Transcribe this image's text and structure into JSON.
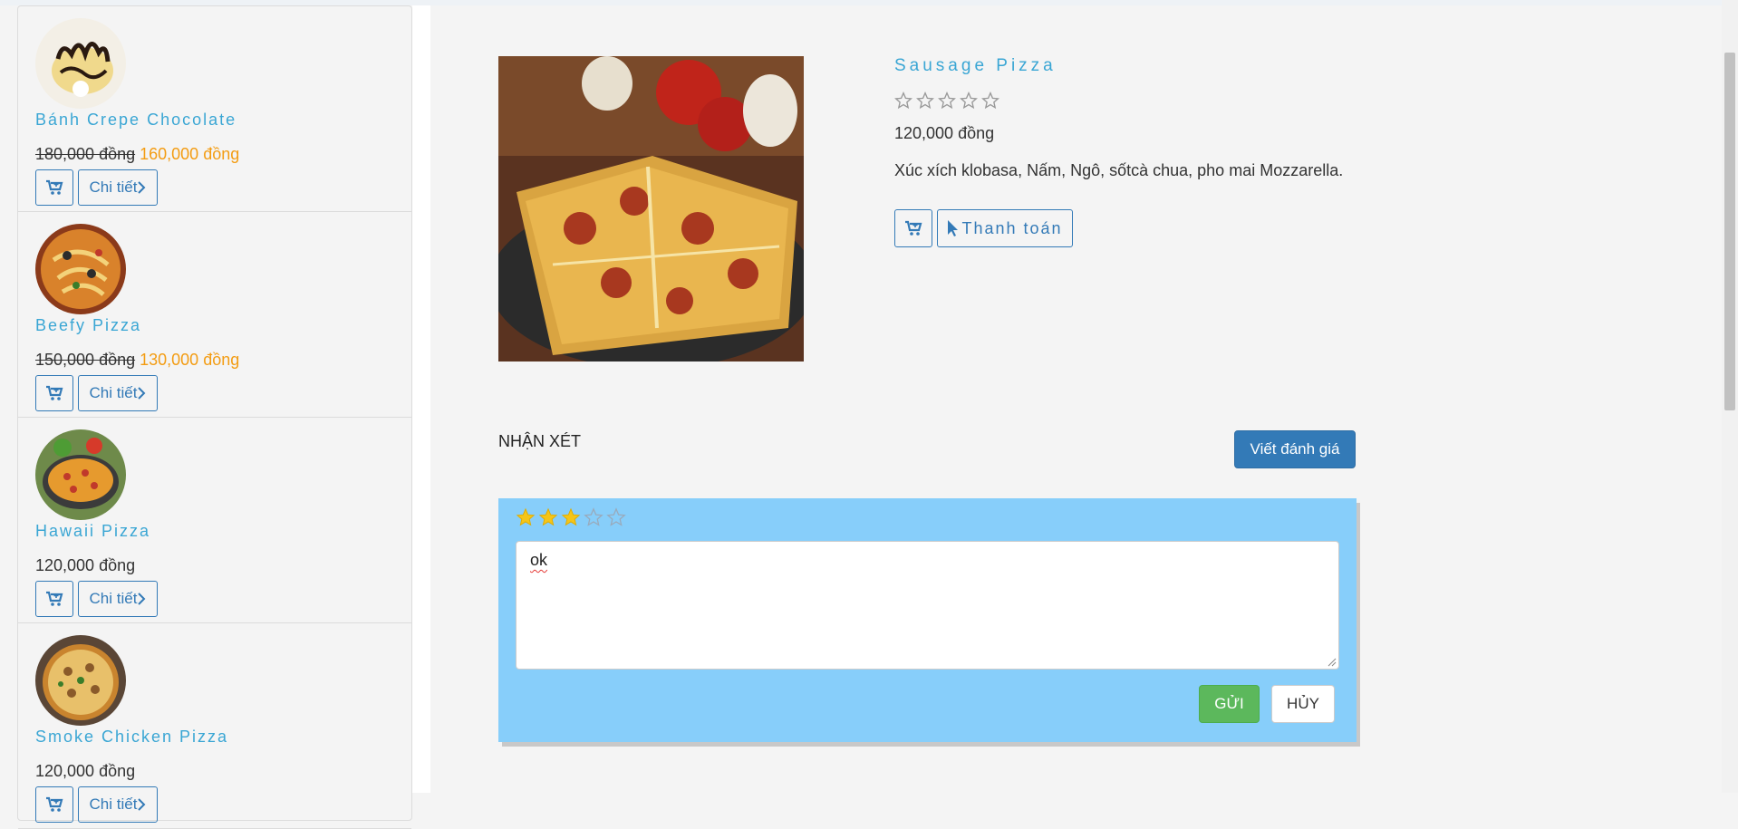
{
  "sidebar": {
    "products": [
      {
        "name": "Bánh Crepe Chocolate",
        "old_price": "180,000 đồng",
        "price": "160,000 đồng",
        "detail_label": "Chi tiết"
      },
      {
        "name": "Beefy Pizza",
        "old_price": "150,000 đồng",
        "price": "130,000 đồng",
        "detail_label": "Chi tiết"
      },
      {
        "name": "Hawaii Pizza",
        "old_price": "",
        "price": "120,000 đồng",
        "detail_label": "Chi tiết"
      },
      {
        "name": "Smoke Chicken Pizza",
        "old_price": "",
        "price": "120,000 đồng",
        "detail_label": "Chi tiết"
      }
    ]
  },
  "product": {
    "title": "Sausage Pizza",
    "rating": 0,
    "max_rating": 5,
    "price": "120,000 đồng",
    "description": "Xúc xích klobasa, Nấm, Ngô, sốtcà chua, pho mai Mozzarella.",
    "pay_label": "Thanh toán"
  },
  "reviews": {
    "heading": "NHẬN XÉT",
    "write_label": "Viết đánh giá",
    "form": {
      "rating": 3,
      "max_rating": 5,
      "text": "ok",
      "send_label": "GỬI",
      "cancel_label": "HỦY"
    }
  },
  "colors": {
    "accent": "#337ab7",
    "title": "#3aa6d4",
    "sale": "#f39c12",
    "review_bg": "#87cefa",
    "send": "#5cb85c",
    "star": "#f5c518"
  }
}
